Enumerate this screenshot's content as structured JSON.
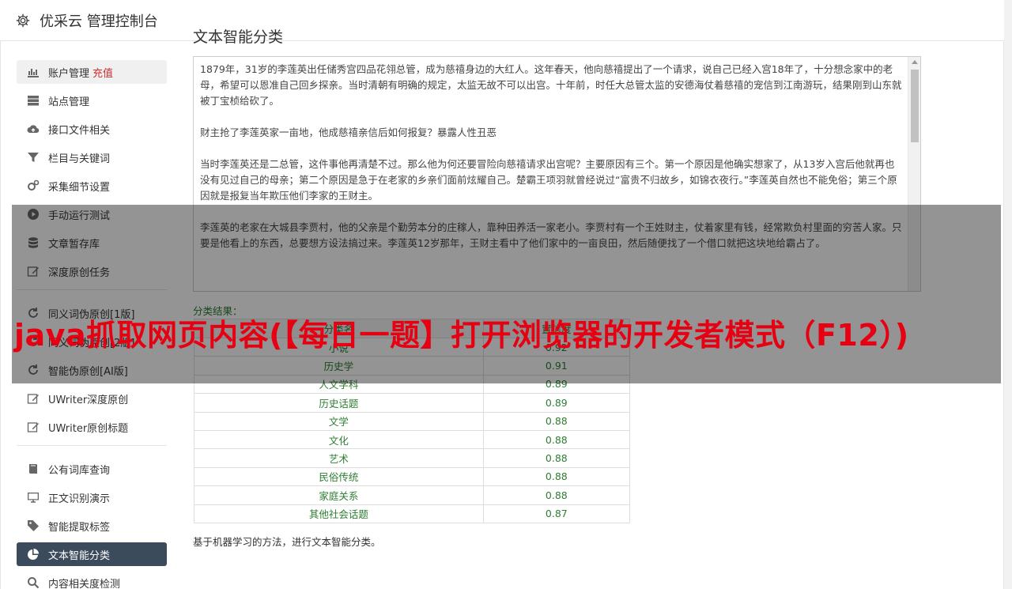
{
  "header": {
    "title": "优采云 管理控制台",
    "icon": "gear-icon"
  },
  "sidebar": {
    "group1": [
      {
        "label": "账户管理",
        "badge": "充值",
        "icon": "bar-chart-icon"
      },
      {
        "label": "站点管理",
        "icon": "server-icon"
      },
      {
        "label": "接口文件相关",
        "icon": "cloud-upload-icon"
      },
      {
        "label": "栏目与关键词",
        "icon": "filter-icon"
      },
      {
        "label": "采集细节设置",
        "icon": "gears-icon"
      },
      {
        "label": "手动运行测试",
        "icon": "play-circle-icon"
      },
      {
        "label": "文章暂存库",
        "icon": "database-icon"
      },
      {
        "label": "深度原创任务",
        "icon": "edit-icon"
      }
    ],
    "group2": [
      {
        "label": "同义词伪原创[1版]",
        "icon": "refresh-icon"
      },
      {
        "label": "同义词伪原创[2版]",
        "icon": "refresh-icon"
      },
      {
        "label": "智能伪原创[AI版]",
        "icon": "refresh-icon"
      },
      {
        "label": "UWriter深度原创",
        "icon": "edit-icon"
      },
      {
        "label": "UWriter原创标题",
        "icon": "edit-icon"
      }
    ],
    "group3": [
      {
        "label": "公有词库查询",
        "icon": "book-icon"
      },
      {
        "label": "正文识别演示",
        "icon": "monitor-icon"
      },
      {
        "label": "智能提取标签",
        "icon": "tag-icon"
      },
      {
        "label": "文本智能分类",
        "icon": "pie-chart-icon"
      },
      {
        "label": "内容相关度检测",
        "icon": "search-icon"
      }
    ]
  },
  "main": {
    "title": "文本智能分类",
    "paragraphs": [
      "1879年，31岁的李莲英出任储秀宫四品花翎总管，成为慈禧身边的大红人。这年春天，他向慈禧提出了一个请求，说自己已经入宫18年了，十分想念家中的老母，希望可以恩准自己回乡探亲。当时清朝有明确的规定，太监无故不可以出宫。十年前，时任大总管太监的安德海仗着慈禧的宠信到江南游玩，结果刚到山东就被丁宝桢给砍了。",
      "财主抢了李莲英家一亩地，他成慈禧亲信后如何报复？暴露人性丑恶",
      "当时李莲英还是二总管，这件事他再清楚不过。那么他为何还要冒险向慈禧请求出宫呢？主要原因有三个。第一个原因是他确实想家了，从13岁入宫后他就再也没有见过自己的母亲；第二个原因是急于在老家的乡亲们面前炫耀自己。楚霸王项羽就曾经说过“富贵不归故乡，如锦衣夜行。”李莲英自然也不能免俗；第三个原因就是报复当年欺压他们李家的王财主。",
      "李莲英的老家在大城县李贾村，他的父亲是个勤劳本分的庄稼人，靠种田养活一家老小。李贾村有一个王姓财主，仗着家里有钱，经常欺负村里面的穷苦人家。只要是他看上的东西，总要想方设法搞过来。李莲英12岁那年，王财主看中了他们家中的一亩良田，然后随便找了一个借口就把这块地给霸占了。"
    ],
    "result_label": "分类结果：",
    "table_headers": [
      "分类名",
      "置信度"
    ],
    "rows": [
      [
        "小说",
        "0.92"
      ],
      [
        "历史学",
        "0.91"
      ],
      [
        "人文学科",
        "0.89"
      ],
      [
        "历史话题",
        "0.89"
      ],
      [
        "文学",
        "0.88"
      ],
      [
        "文化",
        "0.88"
      ],
      [
        "艺术",
        "0.88"
      ],
      [
        "民俗传统",
        "0.88"
      ],
      [
        "家庭关系",
        "0.88"
      ],
      [
        "其他社会话题",
        "0.87"
      ]
    ],
    "footer_note": "基于机器学习的方法，进行文本智能分类。"
  },
  "overlay": {
    "text": "java抓取网页内容(【每日一题】打开浏览器的开发者模式（F12）)",
    "color": "#e60012"
  }
}
